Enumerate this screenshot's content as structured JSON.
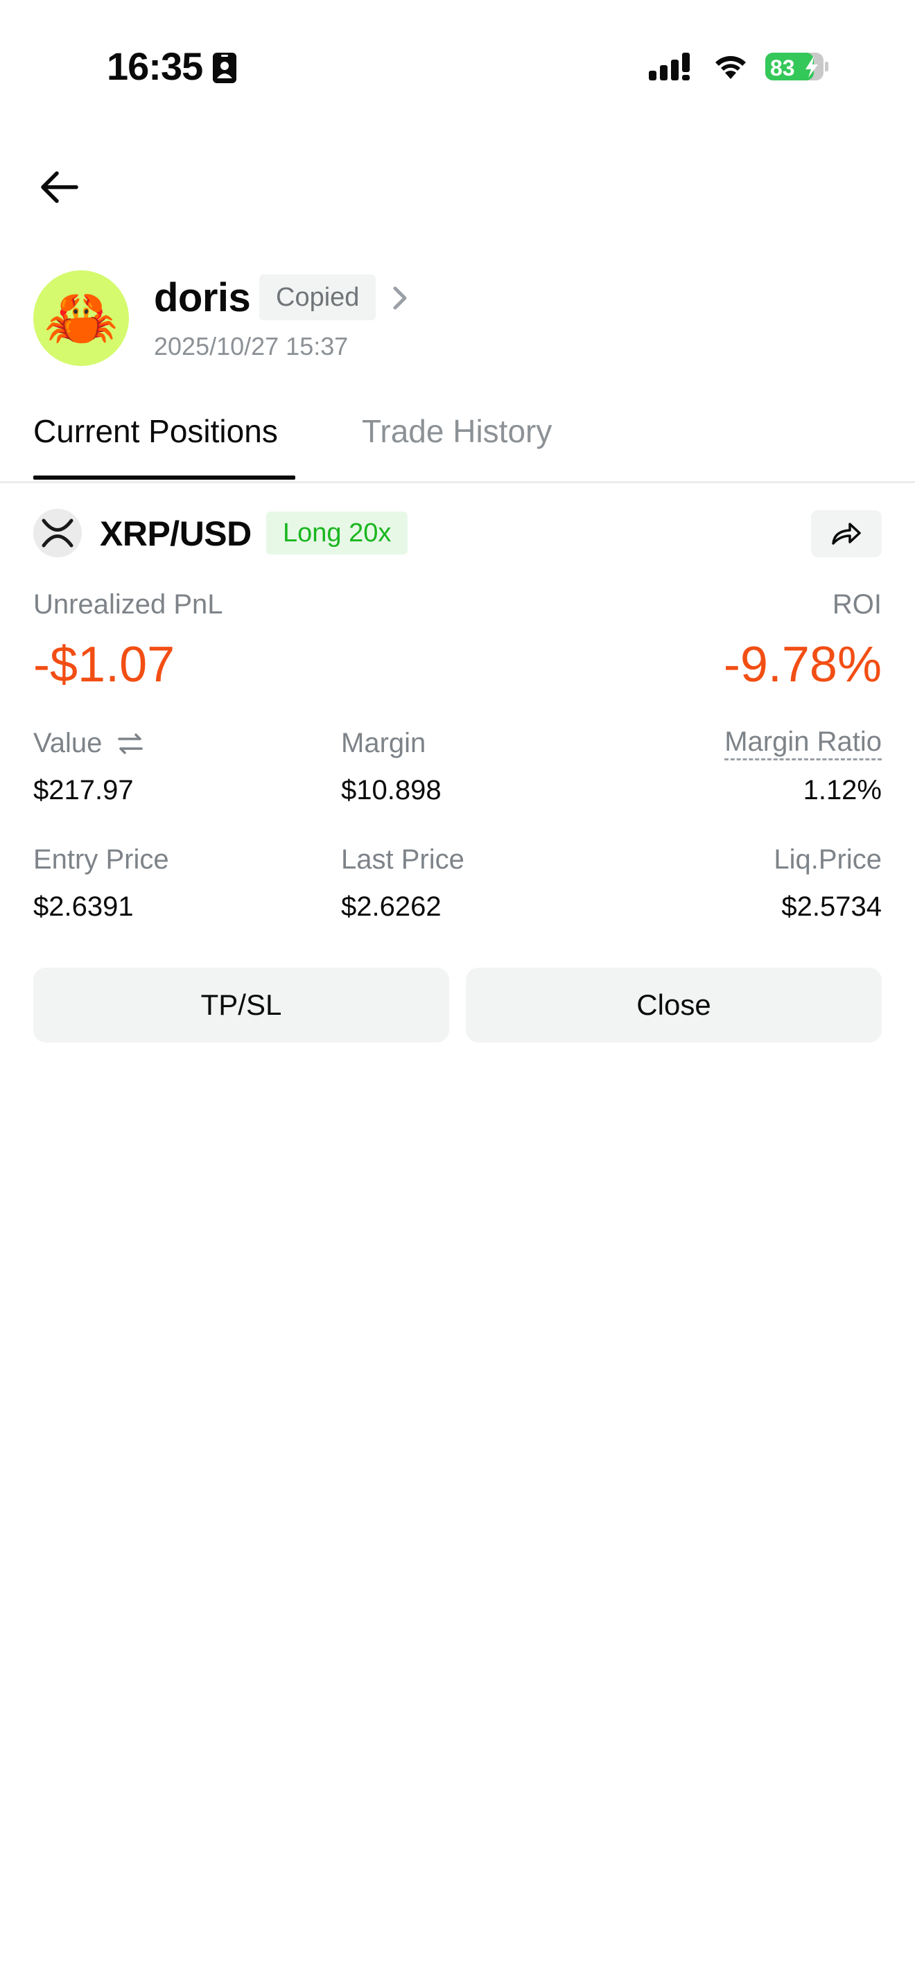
{
  "status_bar": {
    "time": "16:35",
    "battery": "83"
  },
  "profile": {
    "avatar_emoji": "🦀",
    "avatar_bg": "#d5fa6e",
    "name": "doris",
    "badge": "Copied",
    "date": "2025/10/27 15:37"
  },
  "tabs": [
    {
      "label": "Current Positions",
      "active": true
    },
    {
      "label": "Trade History",
      "active": false
    }
  ],
  "position": {
    "pair": "XRP/USD",
    "side_badge": "Long 20x",
    "unrealized_pnl_label": "Unrealized PnL",
    "unrealized_pnl": "-$1.07",
    "roi_label": "ROI",
    "roi": "-9.78%",
    "value_label": "Value",
    "value": "$217.97",
    "margin_label": "Margin",
    "margin": "$10.898",
    "margin_ratio_label": "Margin Ratio",
    "margin_ratio": "1.12%",
    "entry_price_label": "Entry Price",
    "entry_price": "$2.6391",
    "last_price_label": "Last Price",
    "last_price": "$2.6262",
    "liq_price_label": "Liq.Price",
    "liq_price": "$2.5734"
  },
  "actions": {
    "tpsl": "TP/SL",
    "close": "Close"
  },
  "colors": {
    "loss": "#f24e14",
    "long": "#1ab61f",
    "battery": "#34c759"
  }
}
